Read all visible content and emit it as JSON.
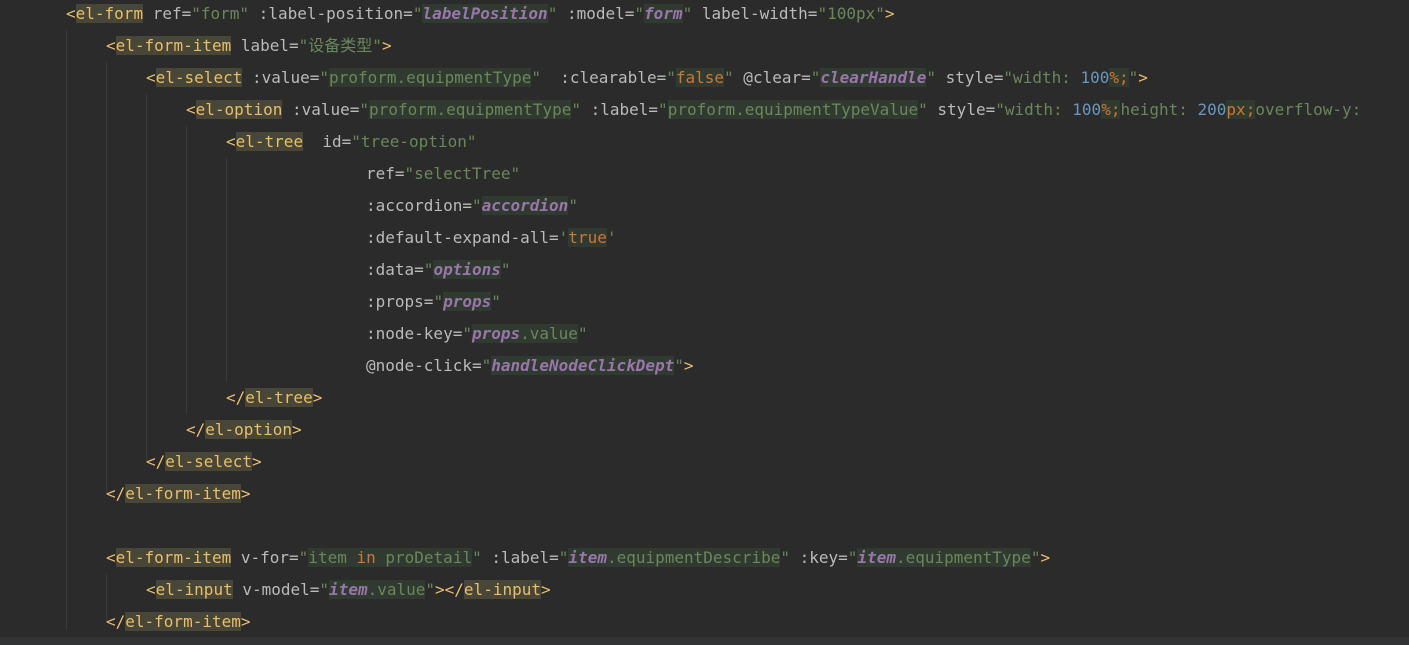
{
  "editor": {
    "theme": {
      "background": "#2b2b2b",
      "tag": "#e8bf6a",
      "string": "#6a8759",
      "attribute": "#bababa",
      "identifier": "#9876aa",
      "number": "#6897bb",
      "keyword": "#cc7832"
    },
    "lines": [
      {
        "indent": 0,
        "segs": [
          {
            "t": "<",
            "c": "c-bracket"
          },
          {
            "t": "el-form",
            "c": "c-tag-hl"
          },
          {
            "t": " ref=",
            "c": "c-attr"
          },
          {
            "t": "\"form\"",
            "c": "c-str"
          },
          {
            "t": " :label-position=",
            "c": "c-attr"
          },
          {
            "t": "\"",
            "c": "c-str"
          },
          {
            "t": "labelPosition",
            "c": "c-ident"
          },
          {
            "t": "\"",
            "c": "c-str"
          },
          {
            "t": " :model=",
            "c": "c-attr"
          },
          {
            "t": "\"",
            "c": "c-str"
          },
          {
            "t": "form",
            "c": "c-ident"
          },
          {
            "t": "\"",
            "c": "c-str"
          },
          {
            "t": " label-width=",
            "c": "c-attr"
          },
          {
            "t": "\"100px\"",
            "c": "c-str"
          },
          {
            "t": ">",
            "c": "c-bracket"
          }
        ]
      },
      {
        "indent": 1,
        "segs": [
          {
            "t": "<",
            "c": "c-bracket"
          },
          {
            "t": "el-form-item",
            "c": "c-tag-hl"
          },
          {
            "t": " label=",
            "c": "c-attr"
          },
          {
            "t": "\"设备类型\"",
            "c": "c-str"
          },
          {
            "t": ">",
            "c": "c-bracket"
          }
        ]
      },
      {
        "indent": 2,
        "segs": [
          {
            "t": "<",
            "c": "c-bracket"
          },
          {
            "t": "el-select",
            "c": "c-tag-hl"
          },
          {
            "t": " :value=",
            "c": "c-attr"
          },
          {
            "t": "\"",
            "c": "c-str"
          },
          {
            "t": "proform.equipmentType",
            "c": "c-strv"
          },
          {
            "t": "\"",
            "c": "c-str"
          },
          {
            "t": "  :clearable=",
            "c": "c-attr"
          },
          {
            "t": "\"",
            "c": "c-str"
          },
          {
            "t": "false",
            "c": "c-kw"
          },
          {
            "t": "\"",
            "c": "c-str"
          },
          {
            "t": " @clear=",
            "c": "c-attr"
          },
          {
            "t": "\"",
            "c": "c-str"
          },
          {
            "t": "clearHandle",
            "c": "c-ident"
          },
          {
            "t": "\"",
            "c": "c-str"
          },
          {
            "t": " style=",
            "c": "c-attr"
          },
          {
            "t": "\"width: ",
            "c": "c-str"
          },
          {
            "t": "100",
            "c": "c-num"
          },
          {
            "t": "%;",
            "c": "c-kw"
          },
          {
            "t": "\"",
            "c": "c-str"
          },
          {
            "t": ">",
            "c": "c-bracket"
          }
        ]
      },
      {
        "indent": 3,
        "segs": [
          {
            "t": "<",
            "c": "c-bracket"
          },
          {
            "t": "el-option",
            "c": "c-tag-hl"
          },
          {
            "t": " :value=",
            "c": "c-attr"
          },
          {
            "t": "\"",
            "c": "c-str"
          },
          {
            "t": "proform.equipmentType",
            "c": "c-strv"
          },
          {
            "t": "\"",
            "c": "c-str"
          },
          {
            "t": " :label=",
            "c": "c-attr"
          },
          {
            "t": "\"",
            "c": "c-str"
          },
          {
            "t": "proform.equipmentTypeValue",
            "c": "c-strv"
          },
          {
            "t": "\"",
            "c": "c-str"
          },
          {
            "t": " style=",
            "c": "c-attr"
          },
          {
            "t": "\"width: ",
            "c": "c-str"
          },
          {
            "t": "100",
            "c": "c-num"
          },
          {
            "t": "%;",
            "c": "c-kw"
          },
          {
            "t": "height: ",
            "c": "c-str"
          },
          {
            "t": "200",
            "c": "c-num"
          },
          {
            "t": "px;",
            "c": "c-kw"
          },
          {
            "t": "overflow-y:",
            "c": "c-str"
          }
        ]
      },
      {
        "indent": 4,
        "segs": [
          {
            "t": "<",
            "c": "c-bracket"
          },
          {
            "t": "el-tree",
            "c": "c-tag-hl"
          },
          {
            "t": "  id=",
            "c": "c-attr"
          },
          {
            "t": "\"tree-option\"",
            "c": "c-str"
          }
        ]
      },
      {
        "indent": 7.5,
        "segs": [
          {
            "t": "ref=",
            "c": "c-attr"
          },
          {
            "t": "\"selectTree\"",
            "c": "c-str"
          }
        ]
      },
      {
        "indent": 7.5,
        "segs": [
          {
            "t": ":accordion=",
            "c": "c-attr"
          },
          {
            "t": "\"",
            "c": "c-str"
          },
          {
            "t": "accordion",
            "c": "c-ident"
          },
          {
            "t": "\"",
            "c": "c-str"
          }
        ]
      },
      {
        "indent": 7.5,
        "segs": [
          {
            "t": ":default-expand-all=",
            "c": "c-attr"
          },
          {
            "t": "'",
            "c": "c-str"
          },
          {
            "t": "true",
            "c": "c-kw"
          },
          {
            "t": "'",
            "c": "c-str"
          }
        ]
      },
      {
        "indent": 7.5,
        "segs": [
          {
            "t": ":data=",
            "c": "c-attr"
          },
          {
            "t": "\"",
            "c": "c-str"
          },
          {
            "t": "options",
            "c": "c-ident"
          },
          {
            "t": "\"",
            "c": "c-str"
          }
        ]
      },
      {
        "indent": 7.5,
        "segs": [
          {
            "t": ":props=",
            "c": "c-attr"
          },
          {
            "t": "\"",
            "c": "c-str"
          },
          {
            "t": "props",
            "c": "c-ident"
          },
          {
            "t": "\"",
            "c": "c-str"
          }
        ]
      },
      {
        "indent": 7.5,
        "segs": [
          {
            "t": ":node-key=",
            "c": "c-attr"
          },
          {
            "t": "\"",
            "c": "c-str"
          },
          {
            "t": "props",
            "c": "c-ident"
          },
          {
            "t": ".value",
            "c": "c-strv"
          },
          {
            "t": "\"",
            "c": "c-str"
          }
        ]
      },
      {
        "indent": 7.5,
        "segs": [
          {
            "t": "@node-click=",
            "c": "c-attr"
          },
          {
            "t": "\"",
            "c": "c-str"
          },
          {
            "t": "handleNodeClickDept",
            "c": "c-ident"
          },
          {
            "t": "\"",
            "c": "c-str"
          },
          {
            "t": ">",
            "c": "c-bracket"
          }
        ]
      },
      {
        "indent": 4,
        "segs": [
          {
            "t": "</",
            "c": "c-bracket"
          },
          {
            "t": "el-tree",
            "c": "c-tag-hl"
          },
          {
            "t": ">",
            "c": "c-bracket"
          }
        ]
      },
      {
        "indent": 3,
        "segs": [
          {
            "t": "</",
            "c": "c-bracket"
          },
          {
            "t": "el-option",
            "c": "c-tag-hl"
          },
          {
            "t": ">",
            "c": "c-bracket"
          }
        ]
      },
      {
        "indent": 2,
        "segs": [
          {
            "t": "</",
            "c": "c-bracket"
          },
          {
            "t": "el-select",
            "c": "c-tag-hl"
          },
          {
            "t": ">",
            "c": "c-bracket"
          }
        ]
      },
      {
        "indent": 1,
        "segs": [
          {
            "t": "</",
            "c": "c-bracket"
          },
          {
            "t": "el-form-item",
            "c": "c-tag-hl"
          },
          {
            "t": ">",
            "c": "c-bracket"
          }
        ]
      },
      {
        "indent": 0,
        "segs": []
      },
      {
        "indent": 1,
        "segs": [
          {
            "t": "<",
            "c": "c-bracket"
          },
          {
            "t": "el-form-item",
            "c": "c-tag-hl"
          },
          {
            "t": " v-for=",
            "c": "c-attr"
          },
          {
            "t": "\"",
            "c": "c-str"
          },
          {
            "t": "item ",
            "c": "c-strv"
          },
          {
            "t": "in",
            "c": "c-kw"
          },
          {
            "t": " proDetail",
            "c": "c-strv"
          },
          {
            "t": "\"",
            "c": "c-str"
          },
          {
            "t": " :label=",
            "c": "c-attr"
          },
          {
            "t": "\"",
            "c": "c-str"
          },
          {
            "t": "item",
            "c": "c-ident"
          },
          {
            "t": ".equipmentDescribe",
            "c": "c-strv"
          },
          {
            "t": "\"",
            "c": "c-str"
          },
          {
            "t": " :key=",
            "c": "c-attr"
          },
          {
            "t": "\"",
            "c": "c-str"
          },
          {
            "t": "item",
            "c": "c-ident"
          },
          {
            "t": ".equipmentType",
            "c": "c-strv"
          },
          {
            "t": "\"",
            "c": "c-str"
          },
          {
            "t": ">",
            "c": "c-bracket"
          }
        ]
      },
      {
        "indent": 2,
        "segs": [
          {
            "t": "<",
            "c": "c-bracket"
          },
          {
            "t": "el-input",
            "c": "c-tag-hl"
          },
          {
            "t": " v-model=",
            "c": "c-attr"
          },
          {
            "t": "\"",
            "c": "c-str"
          },
          {
            "t": "item",
            "c": "c-ident"
          },
          {
            "t": ".value",
            "c": "c-strv"
          },
          {
            "t": "\"",
            "c": "c-str"
          },
          {
            "t": "></",
            "c": "c-bracket"
          },
          {
            "t": "el-input",
            "c": "c-tag-hl"
          },
          {
            "t": ">",
            "c": "c-bracket"
          }
        ]
      },
      {
        "indent": 1,
        "segs": [
          {
            "t": "</",
            "c": "c-bracket"
          },
          {
            "t": "el-form-item",
            "c": "c-tag-hl"
          },
          {
            "t": ">",
            "c": "c-bracket"
          }
        ]
      }
    ]
  }
}
